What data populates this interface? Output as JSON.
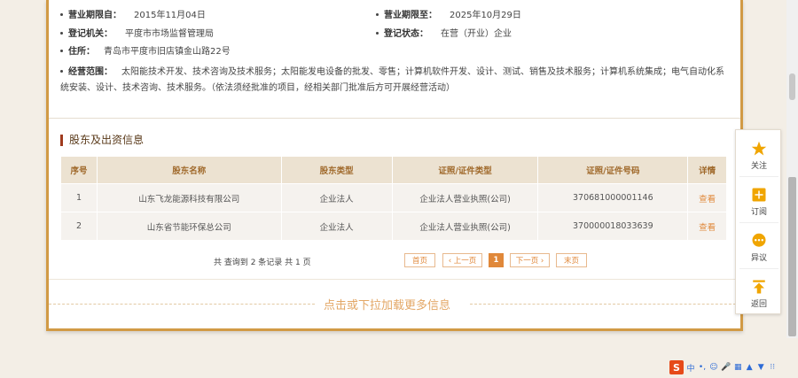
{
  "company": {
    "rows": [
      {
        "label": "营业期限自：",
        "value": "2015年11月04日"
      },
      {
        "label": "营业期限至：",
        "value": "2025年10月29日"
      },
      {
        "label": "登记机关：",
        "value": "平度市市场监督管理局"
      },
      {
        "label": "登记状态：",
        "value": "在营（开业）企业"
      },
      {
        "label": "住所：",
        "value": "青岛市平度市旧店镇金山路22号"
      }
    ],
    "scope_label": "经营范围：",
    "scope_line1": "太阳能技术开发、技术咨询及技术服务；太阳能发电设备的批发、零售；计算机软件开发、设计、测试、销售及技术服务；计算机系统集成；电气自动化系",
    "scope_line2": "统安装、设计、技术咨询、技术服务。（依法须经批准的项目，经相关部门批准后方可开展经营活动）"
  },
  "section": {
    "title": "股东及出资信息"
  },
  "table": {
    "headers": [
      "序号",
      "股东名称",
      "股东类型",
      "证照/证件类型",
      "证照/证件号码",
      "详情"
    ],
    "rows": [
      [
        "1",
        "山东飞龙能源科技有限公司",
        "企业法人",
        "企业法人营业执照(公司)",
        "370681000001146",
        "查看"
      ],
      [
        "2",
        "山东省节能环保总公司",
        "企业法人",
        "企业法人营业执照(公司)",
        "370000018033639",
        "查看"
      ]
    ]
  },
  "pager": {
    "summary": "共 查询到 2 条记录 共 1 页",
    "first": "首页",
    "prev": "‹ 上一页",
    "current": "1",
    "next": "下一页 ›",
    "last": "末页"
  },
  "load_more": "点击或下拉加载更多信息",
  "sidebar": {
    "items": [
      {
        "label": "关注",
        "icon": "star-icon"
      },
      {
        "label": "订阅",
        "icon": "subscribe-icon"
      },
      {
        "label": "异议",
        "icon": "objection-icon"
      },
      {
        "label": "返回",
        "icon": "back-top-icon"
      }
    ],
    "accent": "#f0a500"
  },
  "ime": {
    "brand": "S",
    "mode": "中"
  },
  "colors": {
    "border": "#d19a45",
    "header_bg": "#ece2d1",
    "link": "#e0883a"
  }
}
